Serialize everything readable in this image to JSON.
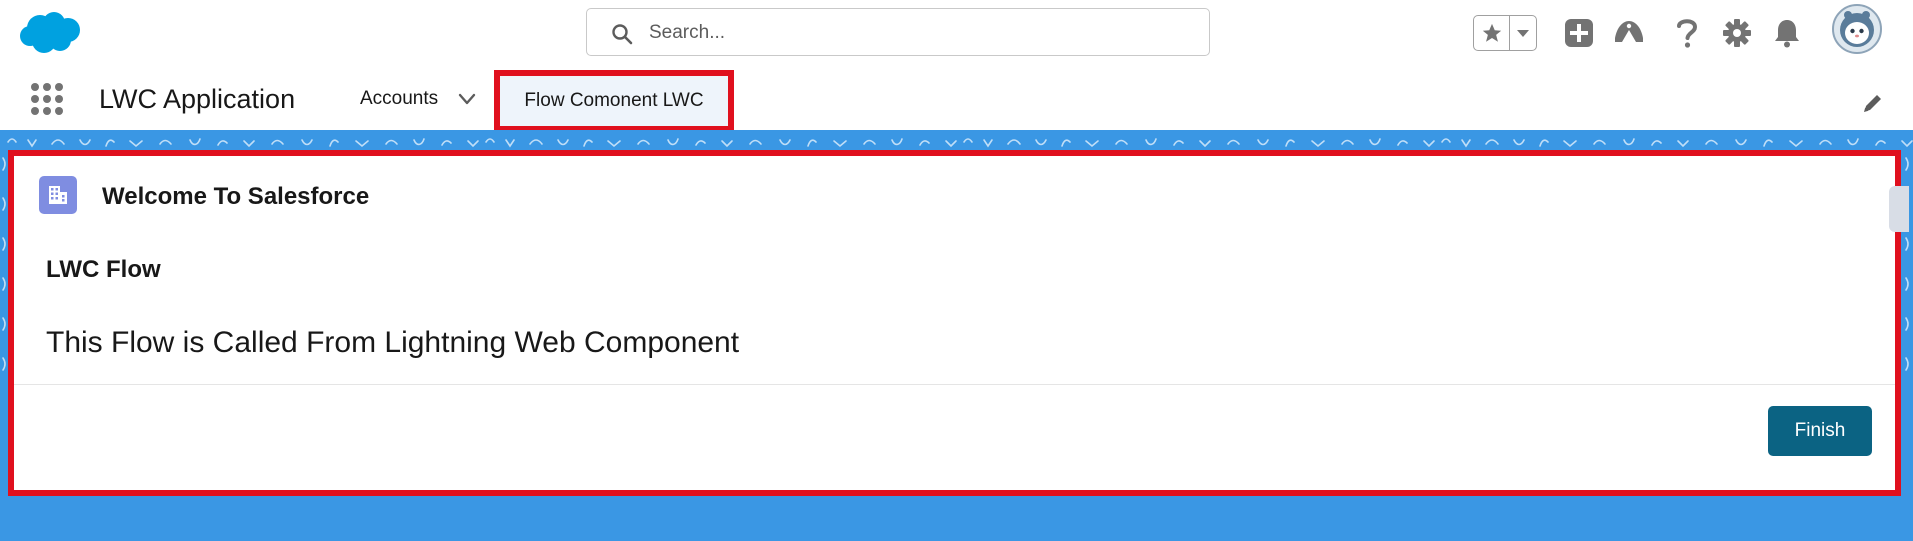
{
  "header": {
    "logo": "salesforce-cloud-logo",
    "search": {
      "placeholder": "Search...",
      "value": ""
    },
    "icons": [
      "star-icon",
      "chevron-down-icon",
      "add-icon",
      "trailhead-icon",
      "help-icon",
      "gear-icon",
      "bell-icon",
      "avatar"
    ]
  },
  "nav": {
    "app_name": "LWC Application",
    "items": [
      {
        "label": "Accounts",
        "has_dropdown": true
      },
      {
        "label": "Flow Comonent LWC",
        "active": true
      }
    ]
  },
  "card": {
    "title": "Welcome To Salesforce",
    "flow_title": "LWC Flow",
    "flow_text": "This Flow is Called From Lightning Web Component",
    "finish_label": "Finish"
  },
  "colors": {
    "brand_blue": "#00A1E0",
    "page_bg": "#3A97E4",
    "highlight_red": "#E0101E",
    "button_bg": "#0B6383",
    "card_icon_bg": "#7F8DE1"
  }
}
